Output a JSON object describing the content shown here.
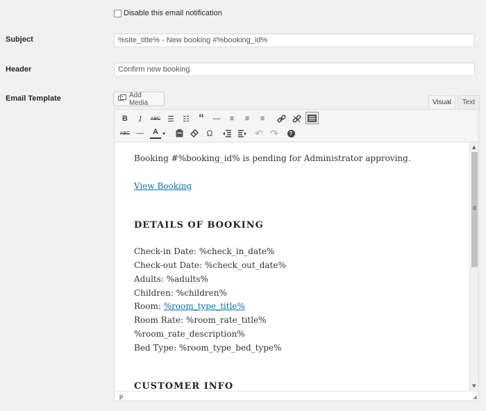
{
  "disable_notification": {
    "label": "Disable this email notification",
    "checked": false
  },
  "subject": {
    "label": "Subject",
    "value": "%site_title% - New booking #%booking_id%"
  },
  "header": {
    "label": "Header",
    "value": "Confirm new booking"
  },
  "email_template": {
    "label": "Email Template",
    "add_media_label": "Add Media",
    "tabs": {
      "visual": "Visual",
      "text": "Text",
      "active": "visual"
    },
    "toolbar_row1": [
      "bold-icon",
      "italic-icon",
      "strikethrough-icon",
      "bulleted-list-icon",
      "numbered-list-icon",
      "blockquote-icon",
      "horizontal-line-icon",
      "align-left-icon",
      "align-center-icon",
      "align-right-icon",
      "insert-link-icon",
      "remove-link-icon",
      "toolbar-toggle-icon"
    ],
    "toolbar_row2": [
      "strikethrough-icon",
      "horizontal-line-icon",
      "text-color-icon",
      "paste-as-text-icon",
      "clear-formatting-icon",
      "special-character-icon",
      "decrease-indent-icon",
      "increase-indent-icon",
      "undo-icon",
      "redo-icon",
      "help-icon"
    ],
    "glyphs": {
      "bold": "B",
      "italic": "I",
      "strike": "ABC",
      "ul": "☰",
      "ol": "☷",
      "quote": "“",
      "hr": "—",
      "al": "≡",
      "ac": "≡",
      "ar": "≡",
      "link": "🔗",
      "unlink": "⛓",
      "kitchen": "▦",
      "textcolor": "A",
      "caret": "▾",
      "paste": "📋",
      "erase": "⌫",
      "omega": "Ω",
      "outdent": "⇤",
      "indent": "⇥",
      "undo": "↶",
      "redo": "↷",
      "help": "?"
    },
    "content": {
      "intro": "Booking #%booking_id% is pending for Administrator approving.",
      "view_link": "View Booking",
      "details_heading": "DETAILS OF BOOKING",
      "details": {
        "checkin": "Check-in Date: %check_in_date%",
        "checkout": "Check-out Date: %check_out_date%",
        "adults": "Adults: %adults%",
        "children": "Children: %children%",
        "room_prefix": "Room: ",
        "room_link": "%room_type_title%",
        "rate": "Room Rate: %room_rate_title%",
        "rate_desc": "%room_rate_description%",
        "bed": "Bed Type: %room_type_bed_type%"
      },
      "customer_heading": "CUSTOMER INFO"
    },
    "status_path": "p"
  }
}
